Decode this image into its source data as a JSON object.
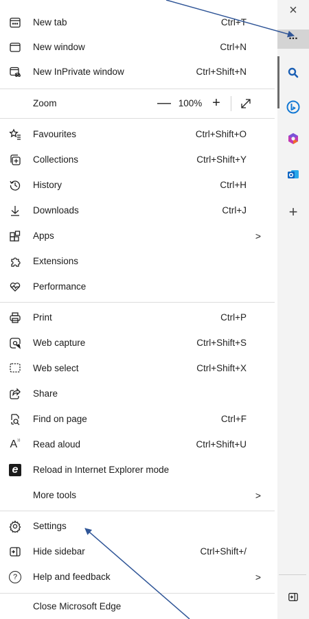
{
  "menu": {
    "new_tab": {
      "label": "New tab",
      "shortcut": "Ctrl+T"
    },
    "new_window": {
      "label": "New window",
      "shortcut": "Ctrl+N"
    },
    "new_inprivate": {
      "label": "New InPrivate window",
      "shortcut": "Ctrl+Shift+N"
    },
    "zoom": {
      "label": "Zoom",
      "minus": "—",
      "value": "100%",
      "plus": "+",
      "fullscreen_glyph": "⤢"
    },
    "favourites": {
      "label": "Favourites",
      "shortcut": "Ctrl+Shift+O"
    },
    "collections": {
      "label": "Collections",
      "shortcut": "Ctrl+Shift+Y"
    },
    "history": {
      "label": "History",
      "shortcut": "Ctrl+H"
    },
    "downloads": {
      "label": "Downloads",
      "shortcut": "Ctrl+J"
    },
    "apps": {
      "label": "Apps",
      "arrow": ">"
    },
    "extensions": {
      "label": "Extensions"
    },
    "performance": {
      "label": "Performance"
    },
    "print": {
      "label": "Print",
      "shortcut": "Ctrl+P"
    },
    "web_capture": {
      "label": "Web capture",
      "shortcut": "Ctrl+Shift+S"
    },
    "web_select": {
      "label": "Web select",
      "shortcut": "Ctrl+Shift+X"
    },
    "share": {
      "label": "Share"
    },
    "find_on_page": {
      "label": "Find on page",
      "shortcut": "Ctrl+F"
    },
    "read_aloud": {
      "label": "Read aloud",
      "shortcut": "Ctrl+Shift+U",
      "icon_glyph": "A"
    },
    "reload_ie": {
      "label": "Reload in Internet Explorer mode",
      "icon_glyph": "e"
    },
    "more_tools": {
      "label": "More tools",
      "arrow": ">"
    },
    "settings": {
      "label": "Settings"
    },
    "hide_sidebar": {
      "label": "Hide sidebar",
      "shortcut": "Ctrl+Shift+/"
    },
    "help_feedback": {
      "label": "Help and feedback",
      "arrow": ">",
      "icon_glyph": "?"
    },
    "close_edge": {
      "label": "Close Microsoft Edge"
    }
  },
  "sidebar": {
    "close_glyph": "×",
    "more_glyph": "...",
    "add_glyph": "+",
    "search_color": "#1a5fb4",
    "copilot_color": "#1479d4",
    "office_color": "#c239b3",
    "outlook_color": "#0a64c2",
    "outlook_glyph": "o"
  },
  "colors": {
    "annotation_arrow": "#2f5597"
  }
}
